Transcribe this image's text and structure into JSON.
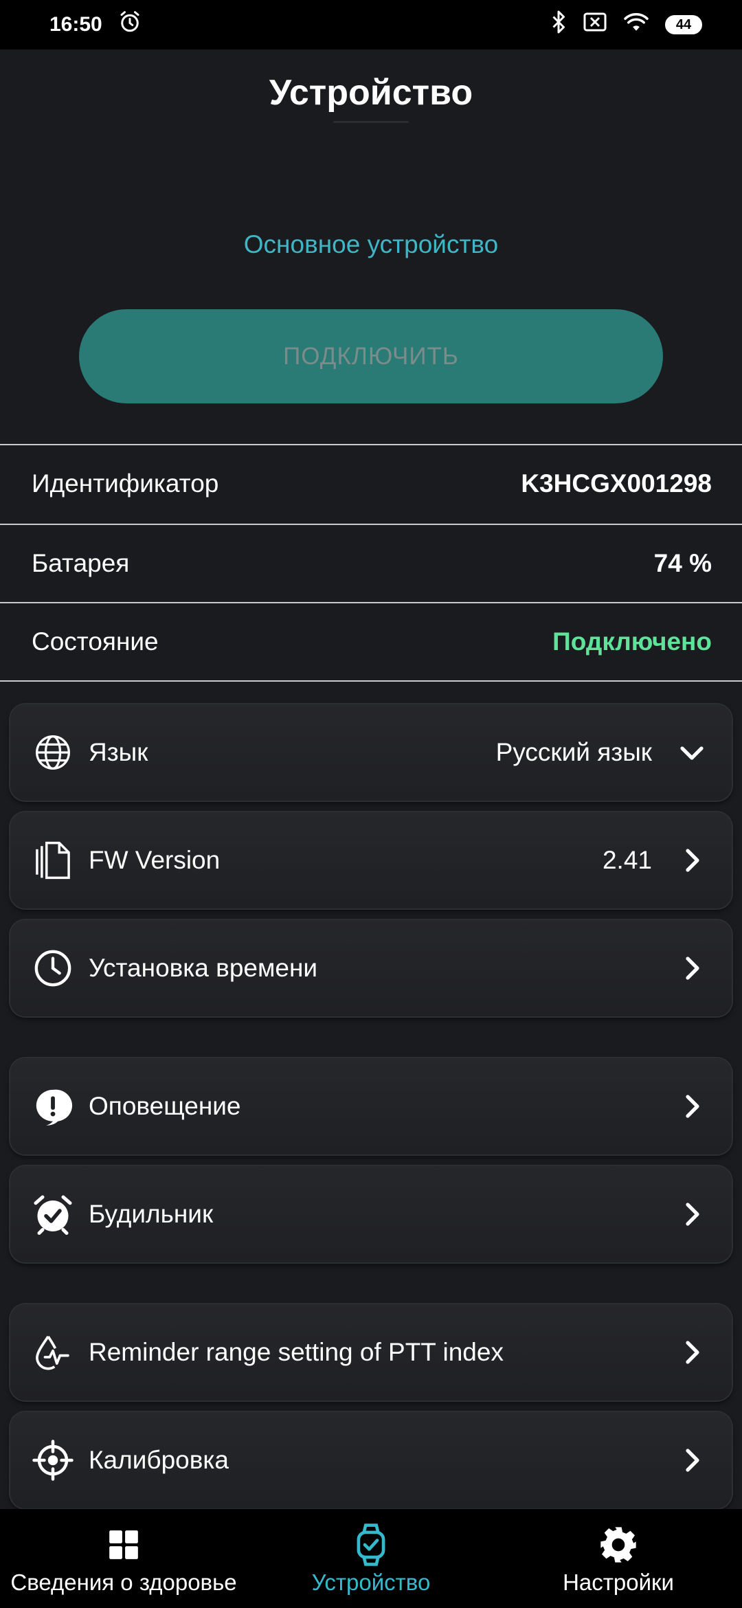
{
  "status_bar": {
    "time": "16:50",
    "battery": "44"
  },
  "header": {
    "title": "Устройство"
  },
  "device": {
    "subtitle": "Основное устройство",
    "connect_label": "ПОДКЛЮЧИТЬ",
    "rows": [
      {
        "label": "Идентификатор",
        "value": "K3HCGX001298"
      },
      {
        "label": "Батарея",
        "value": "74 %"
      },
      {
        "label": "Состояние",
        "value": "Подключено"
      }
    ]
  },
  "settings": {
    "language": {
      "label": "Язык",
      "value": "Русский язык",
      "icon": "globe-icon"
    },
    "fw_version": {
      "label": "FW Version",
      "value": "2.41",
      "icon": "document-icon"
    },
    "time_setting": {
      "label": "Установка времени",
      "icon": "clock-icon"
    },
    "notification": {
      "label": "Оповещение",
      "icon": "alert-icon"
    },
    "alarm": {
      "label": "Будильник",
      "icon": "alarm-clock-icon"
    },
    "ptt_reminder": {
      "label": "Reminder range setting of PTT index",
      "icon": "drop-pulse-icon"
    },
    "calibration": {
      "label": "Калибровка",
      "icon": "crosshair-icon"
    }
  },
  "nav": {
    "items": [
      {
        "label": "Сведения о здоровье",
        "icon": "grid-icon"
      },
      {
        "label": "Устройство",
        "icon": "watch-icon",
        "active": true
      },
      {
        "label": "Настройки",
        "icon": "gear-icon"
      }
    ]
  },
  "colors": {
    "accent": "#35b9cc",
    "button": "#2a7a76",
    "connected": "#5fe39a",
    "background": "#1a1b1f"
  }
}
